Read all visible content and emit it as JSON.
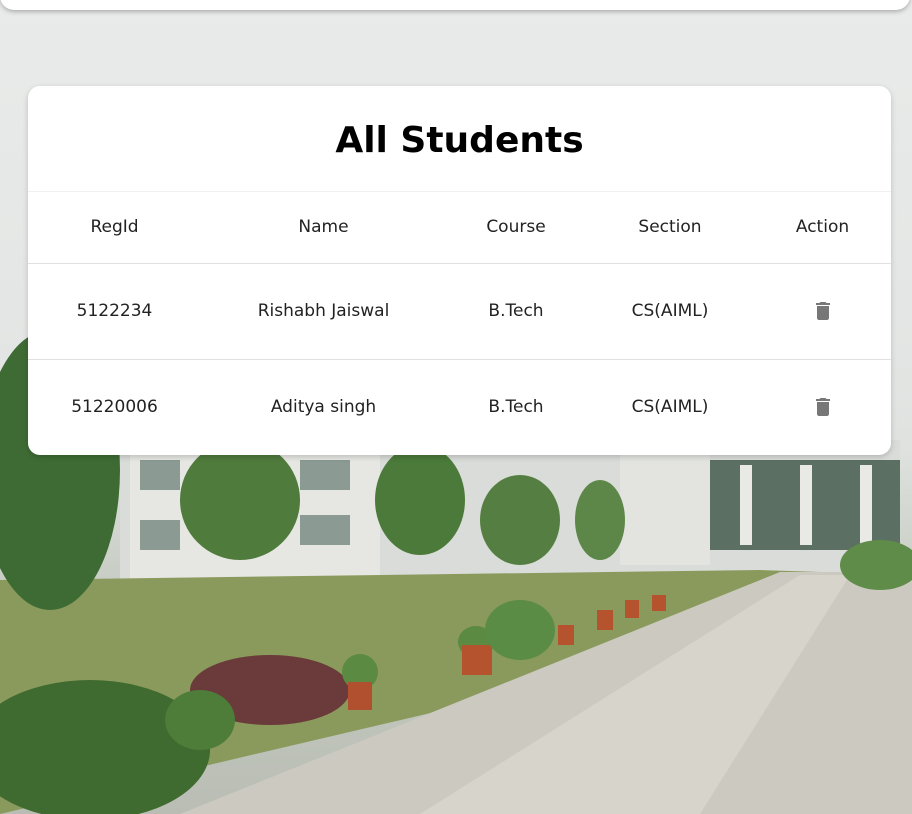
{
  "page": {
    "title": "All Students"
  },
  "table": {
    "headers": [
      "RegId",
      "Name",
      "Course",
      "Section",
      "Action"
    ],
    "rows": [
      {
        "regid": "5122234",
        "name": "Rishabh Jaiswal",
        "course": "B.Tech",
        "section": "CS(AIML)",
        "action_icon": "trash-icon"
      },
      {
        "regid": "51220006",
        "name": "Aditya singh",
        "course": "B.Tech",
        "section": "CS(AIML)",
        "action_icon": "trash-icon"
      }
    ]
  },
  "colors": {
    "card_bg": "#ffffff",
    "icon": "#777777",
    "text": "#222222"
  }
}
